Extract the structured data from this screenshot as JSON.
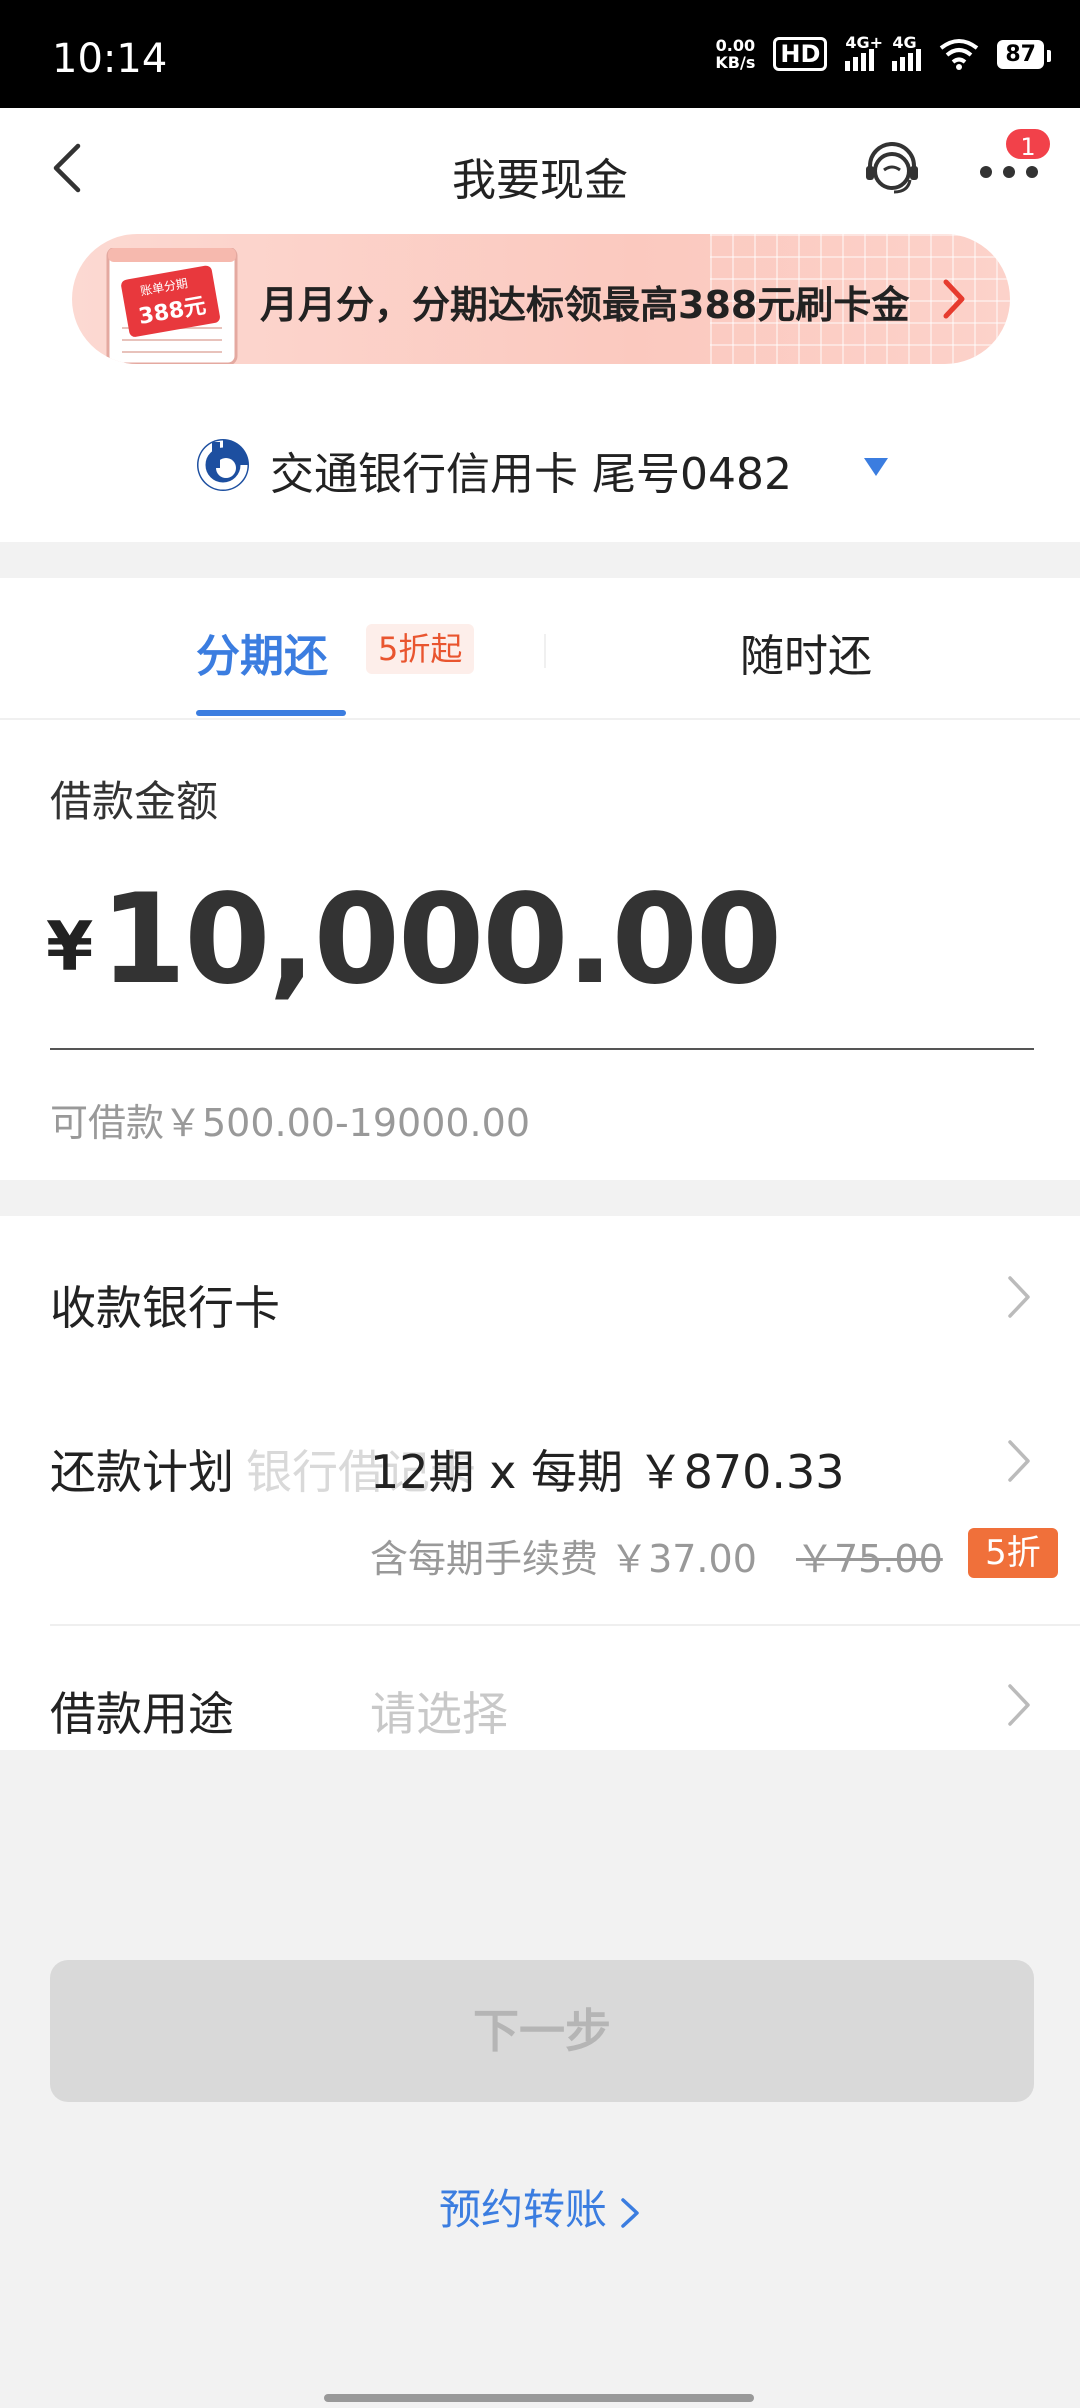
{
  "status_bar": {
    "time": "10:14",
    "net_speed_value": "0.00",
    "net_speed_unit": "KB/s",
    "hd_label": "HD",
    "sim1_label": "4G+",
    "sim2_label": "4G",
    "battery": "87"
  },
  "header": {
    "title": "我要现金",
    "more_badge": "1"
  },
  "banner": {
    "text": "月月分，分期达标领最高388元刷卡金",
    "illus_top": "账单分期",
    "illus_amount": "388元"
  },
  "card": {
    "label": "交通银行信用卡 尾号0482"
  },
  "tabs": {
    "installment": "分期还",
    "installment_badge": "5折起",
    "anytime": "随时还"
  },
  "amount": {
    "label": "借款金额",
    "currency": "¥",
    "value": "10,000.00",
    "range": "可借款￥500.00-19000.00"
  },
  "details": {
    "receive_card_label": "收款银行卡",
    "plan_label": "还款计划",
    "plan_ghost": "银行借记卡",
    "plan_value": "12期 x 每期 ￥870.33",
    "fee_text": "含每期手续费 ￥37.00",
    "fee_old": "￥75.00",
    "fee_badge": "5折",
    "purpose_label": "借款用途",
    "purpose_placeholder": "请选择"
  },
  "actions": {
    "next": "下一步",
    "reserve": "预约转账"
  },
  "colors": {
    "accent_blue": "#3b7de0",
    "badge_orange": "#f0703a",
    "badge_red": "#f2414a"
  }
}
